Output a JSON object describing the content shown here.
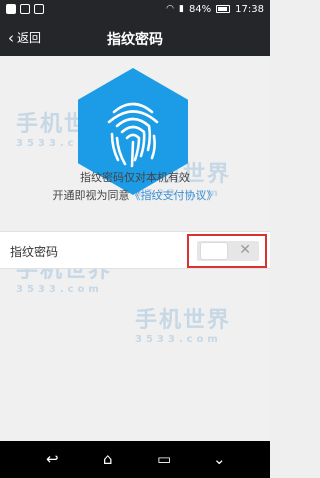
{
  "status_bar": {
    "battery": "84%",
    "time": "17:38"
  },
  "header": {
    "back_label": "返回",
    "title": "指纹密码"
  },
  "content": {
    "description_line1": "指纹密码仅对本机有效",
    "description_line2_prefix": "开通即视为同意",
    "agreement_link": "《指纹支付协议》",
    "setting_label": "指纹密码",
    "toggle_state": "off",
    "toggle_glyph": "✕"
  },
  "watermark": {
    "title": "手机世界",
    "subtitle": "3533.com"
  },
  "nav": {
    "back": "↩",
    "home": "⌂",
    "recents": "▭",
    "menu": "⌄"
  },
  "colors": {
    "accent": "#3b8fd4",
    "hexagon": "#1c9be6",
    "highlight": "#d9332f"
  },
  "icons": [
    "back-arrow-icon",
    "fingerprint-icon",
    "close-icon",
    "nav-back-icon",
    "nav-home-icon",
    "nav-recents-icon",
    "nav-menu-icon"
  ]
}
